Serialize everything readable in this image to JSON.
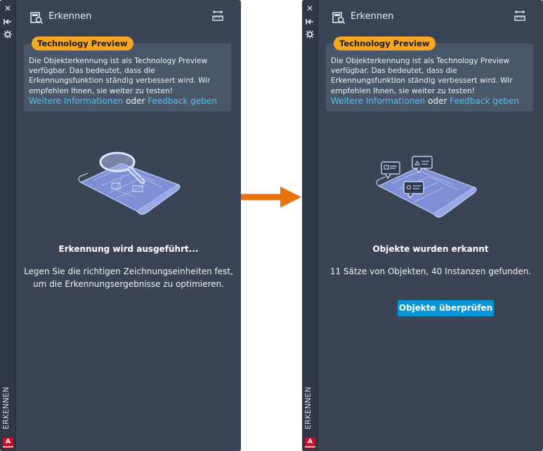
{
  "colors": {
    "panel_bg": "#3b4454",
    "sidestrip_bg": "#2f3644",
    "info_box_bg": "#4a5768",
    "badge_bg": "#f5a623",
    "link": "#4dc3f7",
    "button_bg": "#0696d7",
    "arrow": "#e8730c"
  },
  "palettes": {
    "left": {
      "strip_title": "ERKENNEN",
      "app_logo": "A",
      "title": "Erkennen",
      "badge": "Technology Preview",
      "info_text": "Die Objekterkennung ist als Technology Preview verfügbar. Das bedeutet, dass die Erkennungsfunktion ständig verbessert wird. Wir empfehlen Ihnen, sie weiter zu testen!",
      "link_more": "Weitere Informationen",
      "link_joiner": "oder",
      "link_feedback": "Feedback geben",
      "status_title": "Erkennung wird ausgeführt...",
      "status_desc": "Legen Sie die richtigen Zeichnungseinheiten fest, um die Erkennungsergebnisse zu optimieren."
    },
    "right": {
      "strip_title": "ERKENNEN",
      "app_logo": "A",
      "title": "Erkennen",
      "badge": "Technology Preview",
      "info_text": "Die Objekterkennung ist als Technology Preview verfügbar. Das bedeutet, dass die Erkennungsfunktion ständig verbessert wird. Wir empfehlen Ihnen, sie weiter zu testen!",
      "link_more": "Weitere Informationen",
      "link_joiner": "oder",
      "link_feedback": "Feedback geben",
      "status_title": "Objekte wurden erkannt",
      "status_desc": "11 Sätze von Objekten, 40 Instanzen gefunden.",
      "button_label": "Objekte überprüfen"
    }
  },
  "icons": {
    "close": "close-icon",
    "pin": "auto-hide-icon",
    "properties": "properties-icon",
    "detect": "detect-icon",
    "settings": "drawing-units-icon",
    "illustration_left": "blueprint-magnifier-illustration",
    "illustration_right": "blueprint-detected-objects-illustration",
    "arrow": "arrow-right-icon"
  }
}
